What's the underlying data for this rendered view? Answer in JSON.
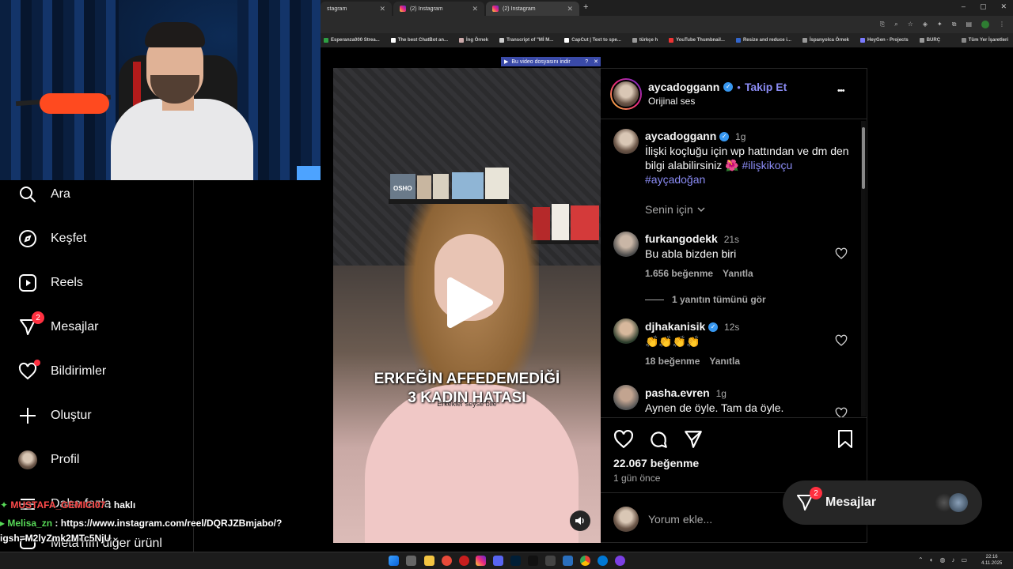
{
  "browser": {
    "tabs": [
      {
        "title": "stagram"
      },
      {
        "title": "(2) Instagram"
      },
      {
        "title": "(2) Instagram"
      }
    ],
    "new_tab": "+",
    "bookmarks": [
      "Esperanza000 Strea...",
      "The best ChatBot an...",
      "İng Örnek",
      "Transcript of \"Mİ M...",
      "CapCut | Text to spe...",
      "türkçe h",
      "YouTube Thumbnail...",
      "Resize and reduce i...",
      "İspanyolca Örnek",
      "HeyGen - Projects",
      "BURÇ"
    ],
    "bookmarks_right": "Tüm Yer İşaretleri",
    "download_bar": "Bu video dosyasını indir",
    "download_help": "?",
    "download_close": "✕"
  },
  "sidebar": {
    "items": [
      {
        "label": "Ara",
        "icon": "search-icon"
      },
      {
        "label": "Keşfet",
        "icon": "compass-icon"
      },
      {
        "label": "Reels",
        "icon": "reels-icon"
      },
      {
        "label": "Mesajlar",
        "icon": "messenger-icon",
        "badge": "2"
      },
      {
        "label": "Bildirimler",
        "icon": "heart-icon"
      },
      {
        "label": "Oluştur",
        "icon": "plus-icon"
      },
      {
        "label": "Profil",
        "icon": "avatar-icon"
      },
      {
        "label": "Daha fazla",
        "icon": "menu-icon"
      },
      {
        "label": "Meta'nın diğer ürünl",
        "icon": "meta-icon"
      }
    ]
  },
  "chat": [
    {
      "user": "MUSTAFA_GEMICI07",
      "text": ": haklı",
      "color": "#ff4b4b"
    },
    {
      "user": "Melisa_zn",
      "text": ": https://www.instagram.com/reel/DQRJZBmjabo/?",
      "color": "#57d957"
    },
    {
      "user": "",
      "text": "igsh=M2lyZmk2MTc5NjU",
      "color": "#ffffff"
    }
  ],
  "video": {
    "caption_line1": "ERKEĞİN AFFEDEMEDİĞİ",
    "caption_line2": "3 KADIN HATASI",
    "caption_sub": "Erkekler seyse bile",
    "books": [
      "OSHO"
    ]
  },
  "post": {
    "author": "aycadoggann",
    "follow": "Takip Et",
    "separator": "•",
    "audio": "Orijinal ses",
    "more": "•••",
    "caption": {
      "user": "aycadoggann",
      "time": "1g",
      "text": "İlişki koçluğu için wp hattından ve dm den bilgi alabilirsiniz 🌺",
      "hashtag1": "#ilişkikoçu",
      "hashtag2": "#ayçadoğan"
    },
    "filter": "Senin için",
    "comments": [
      {
        "user": "furkangodekk",
        "time": "21s",
        "text": "Bu abla bizden biri",
        "likes": "1.656 beğenme",
        "reply": "Yanıtla",
        "replies": "1 yanıtın tümünü gör"
      },
      {
        "user": "djhakanisik",
        "time": "12s",
        "text": "👏👏👏👏",
        "likes": "18 beğenme",
        "reply": "Yanıtla"
      },
      {
        "user": "pasha.evren",
        "time": "1g",
        "text": "Aynen de öyle. Tam da öyle."
      }
    ],
    "likes_total": "22.067 beğenme",
    "posted": "1 gün önce",
    "comment_placeholder": "Yorum ekle..."
  },
  "messages_float": {
    "label": "Mesajlar",
    "badge": "2"
  },
  "taskbar": {
    "time": "22:16",
    "date": "4.11.2025"
  },
  "colors": {
    "accent_link": "#8b8cf5",
    "badge": "#ff3040",
    "verified": "#3797f0"
  }
}
